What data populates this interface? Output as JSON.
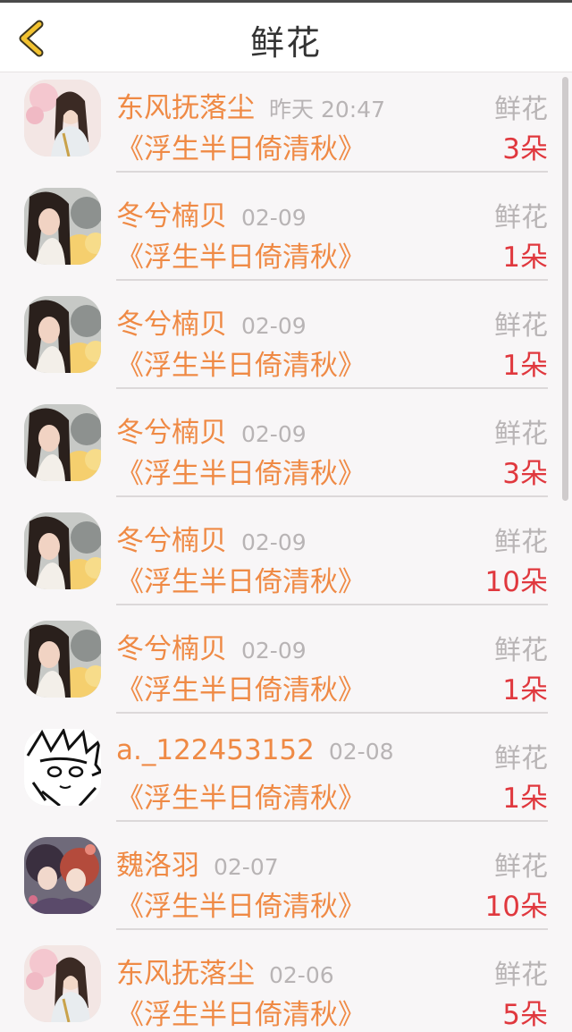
{
  "header": {
    "title": "鲜花"
  },
  "colors": {
    "accent": "#ef8a45",
    "count": "#e0383e",
    "muted": "#b8b4b5",
    "back_icon": "#f2c230"
  },
  "items": [
    {
      "avatar": "girl-portrait-a",
      "name": "东风抚落尘",
      "time": "昨天 20:47",
      "kind": "鲜花",
      "book": "《浮生半日倚清秋》",
      "count": "3朵"
    },
    {
      "avatar": "girl-portrait-b",
      "name": "冬兮楠贝",
      "time": "02-09",
      "kind": "鲜花",
      "book": "《浮生半日倚清秋》",
      "count": "1朵"
    },
    {
      "avatar": "girl-portrait-b",
      "name": "冬兮楠贝",
      "time": "02-09",
      "kind": "鲜花",
      "book": "《浮生半日倚清秋》",
      "count": "1朵"
    },
    {
      "avatar": "girl-portrait-b",
      "name": "冬兮楠贝",
      "time": "02-09",
      "kind": "鲜花",
      "book": "《浮生半日倚清秋》",
      "count": "3朵"
    },
    {
      "avatar": "girl-portrait-b",
      "name": "冬兮楠贝",
      "time": "02-09",
      "kind": "鲜花",
      "book": "《浮生半日倚清秋》",
      "count": "10朵"
    },
    {
      "avatar": "girl-portrait-b",
      "name": "冬兮楠贝",
      "time": "02-09",
      "kind": "鲜花",
      "book": "《浮生半日倚清秋》",
      "count": "1朵"
    },
    {
      "avatar": "manga-sketch",
      "name": "a._122453152",
      "time": "02-08",
      "kind": "鲜花",
      "book": "《浮生半日倚清秋》",
      "count": "1朵"
    },
    {
      "avatar": "anime-couple",
      "name": "魏洛羽",
      "time": "02-07",
      "kind": "鲜花",
      "book": "《浮生半日倚清秋》",
      "count": "10朵"
    },
    {
      "avatar": "girl-portrait-a",
      "name": "东风抚落尘",
      "time": "02-06",
      "kind": "鲜花",
      "book": "《浮生半日倚清秋》",
      "count": "5朵"
    }
  ]
}
